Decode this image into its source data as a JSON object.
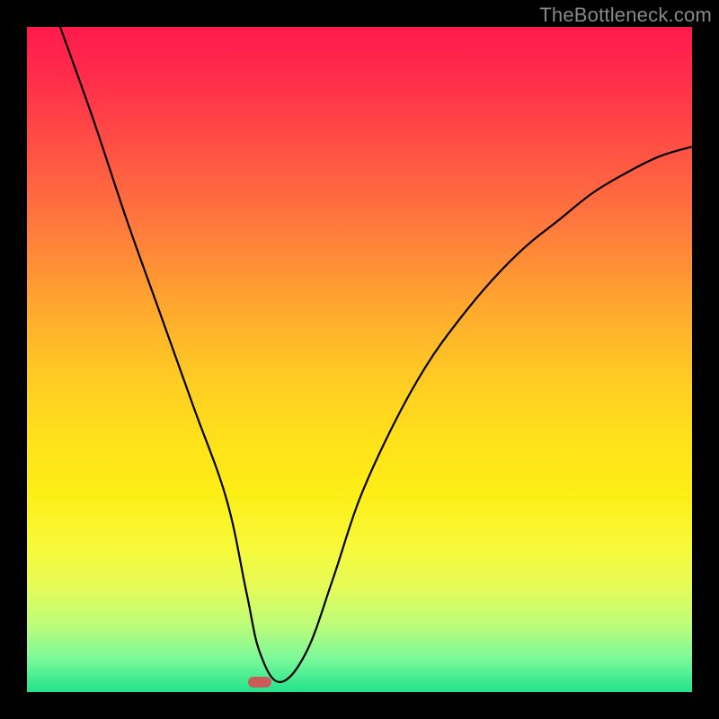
{
  "watermark": {
    "text": "TheBottleneck.com"
  },
  "chart_data": {
    "type": "line",
    "title": "",
    "xlabel": "",
    "ylabel": "",
    "xlim": [
      0,
      100
    ],
    "ylim": [
      0,
      100
    ],
    "series": [
      {
        "name": "curve",
        "x": [
          5,
          10,
          15,
          20,
          25,
          30,
          33,
          35,
          38,
          42,
          46,
          50,
          55,
          60,
          65,
          70,
          75,
          80,
          85,
          90,
          95,
          100
        ],
        "values": [
          100,
          86,
          71,
          57,
          43,
          29,
          15,
          6,
          1.5,
          6,
          17,
          29,
          40,
          49,
          56,
          62,
          67,
          71,
          75,
          78,
          80.5,
          82
        ]
      }
    ],
    "marker": {
      "x": 35,
      "y": 1.5
    },
    "grid": false,
    "legend": false
  },
  "colors": {
    "curve": "#000000",
    "marker": "#cc5a5a",
    "border": "#000000"
  }
}
